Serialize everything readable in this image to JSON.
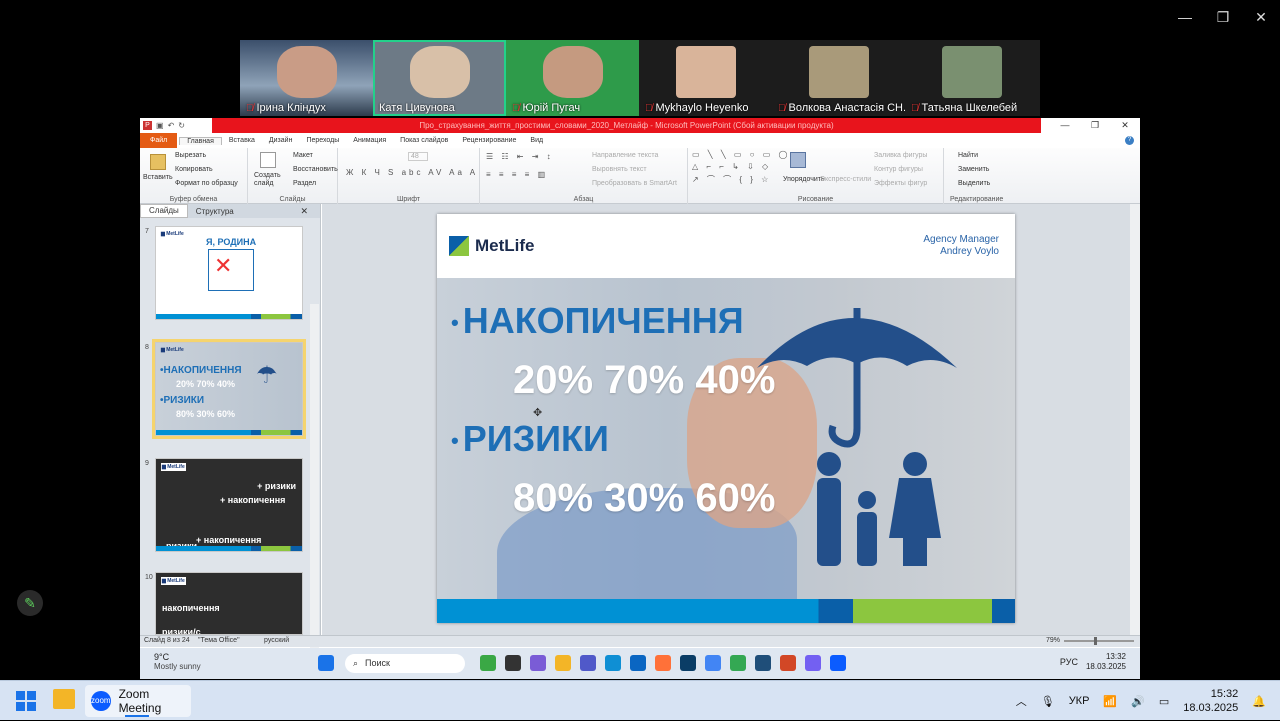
{
  "window": {
    "minimize": "—",
    "restore": "❐",
    "close": "✕"
  },
  "participants": [
    {
      "name": "Ірина Кліндух",
      "muted": true,
      "color": "#6a7f99"
    },
    {
      "name": "Катя Цивунова",
      "muted": false,
      "color": "#b8a890",
      "active": true
    },
    {
      "name": "Юрій Пугач",
      "muted": true,
      "color": "#2e9b4a"
    },
    {
      "name": "Mykhaylo Heyenko",
      "muted": true,
      "color": "#e0e0e0"
    },
    {
      "name": "Волкова Анастасія СН...",
      "muted": true,
      "color": "#a99a7a"
    },
    {
      "name": "Татьяна Шкелебей",
      "muted": true,
      "color": "#7a9070"
    }
  ],
  "ppt": {
    "title": "Про_страхування_життя_простими_словами_2020_Метлайф - Microsoft PowerPoint (Сбой активации продукта)",
    "tabs": [
      "Главная",
      "Вставка",
      "Дизайн",
      "Переходы",
      "Анимация",
      "Показ слайдов",
      "Рецензирование",
      "Вид"
    ],
    "file_tab": "Файл",
    "ribbon": {
      "clipboard": {
        "paste": "Вставить",
        "cut": "Вырезать",
        "copy": "Копировать",
        "format": "Формат по образцу",
        "label": "Буфер обмена"
      },
      "slides": {
        "create": "Создать слайд",
        "layout": "Макет",
        "restore": "Восстановить",
        "section": "Раздел",
        "label": "Слайды"
      },
      "font": {
        "size": "48",
        "label": "Шрифт"
      },
      "paragraph": {
        "dir": "Направление текста",
        "align": "Выровнять текст",
        "smartart": "Преобразовать в SmartArt",
        "label": "Абзац"
      },
      "drawing": {
        "arrange": "Упорядочить",
        "styles": "Экспресс-стили",
        "fill": "Заливка фигуры",
        "outline": "Контур фигуры",
        "effects": "Эффекты фигур",
        "label": "Рисование"
      },
      "editing": {
        "find": "Найти",
        "replace": "Заменить",
        "select": "Выделить",
        "label": "Редактирование"
      }
    },
    "pane_tabs": [
      "Слайды",
      "Структура"
    ],
    "thumbs": [
      {
        "num": "7",
        "text": "Я, РОДИНА"
      },
      {
        "num": "8",
        "lines": [
          "•НАКОПИЧЕННЯ",
          "20% 70% 40%",
          "•РИЗИКИ",
          "80% 30% 60%"
        ]
      },
      {
        "num": "9",
        "lines": [
          "+ ризики",
          "+ накопичення",
          "+ накопичення",
          "ризики"
        ]
      },
      {
        "num": "10",
        "lines": [
          "накопичення",
          "ризики/с"
        ]
      }
    ],
    "slide": {
      "logo": "MetLife",
      "agent_title": "Agency Manager",
      "agent_name": "Andrey Voylo",
      "bullet1": "НАКОПИЧЕННЯ",
      "row1": "20%  70%  40%",
      "bullet2": "РИЗИКИ",
      "row2": "80%  30%  60%"
    },
    "status": {
      "slide": "Слайд 8 из 24",
      "theme": "\"Тема Office\"",
      "lang": "русский",
      "zoom": "79%"
    }
  },
  "remote_taskbar": {
    "temp": "9°C",
    "weather": "Mostly sunny",
    "search": "Поиск",
    "lang": "РУС",
    "time": "13:32",
    "date": "18.03.2025"
  },
  "taskbar": {
    "app": "Zoom Meeting",
    "lang": "УКР",
    "time": "15:32",
    "date": "18.03.2025"
  }
}
